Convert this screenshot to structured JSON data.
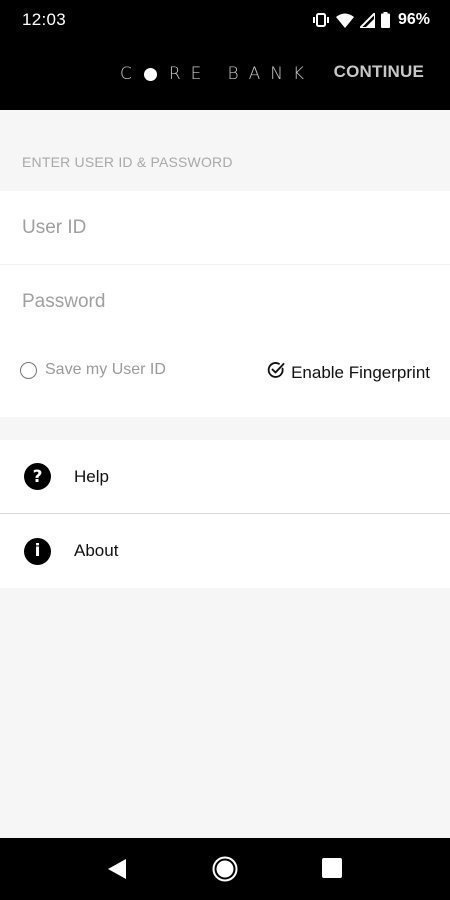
{
  "status_bar": {
    "time": "12:03",
    "battery_percent": "96%",
    "icons": [
      "vibrate-icon",
      "wifi-icon",
      "signal-icon",
      "battery-icon"
    ]
  },
  "header": {
    "logo_part1": "C",
    "logo_part2": "RE",
    "logo_part3": "BANK",
    "continue_label": "CONTINUE"
  },
  "login": {
    "section_label": "ENTER USER ID & PASSWORD",
    "user_id_placeholder": "User ID",
    "user_id_value": "",
    "password_placeholder": "Password",
    "password_value": "",
    "save_user_id_label": "Save my User ID",
    "save_user_id_checked": false,
    "enable_fingerprint_label": "Enable Fingerprint",
    "enable_fingerprint_checked": true
  },
  "menu": {
    "items": [
      {
        "label": "Help",
        "icon": "help-icon",
        "glyph": "?"
      },
      {
        "label": "About",
        "icon": "info-icon",
        "glyph": "i"
      }
    ]
  },
  "colors": {
    "header_bg": "#000000",
    "page_bg": "#f6f6f6",
    "card_bg": "#ffffff",
    "muted_text": "#a0a0a0"
  }
}
